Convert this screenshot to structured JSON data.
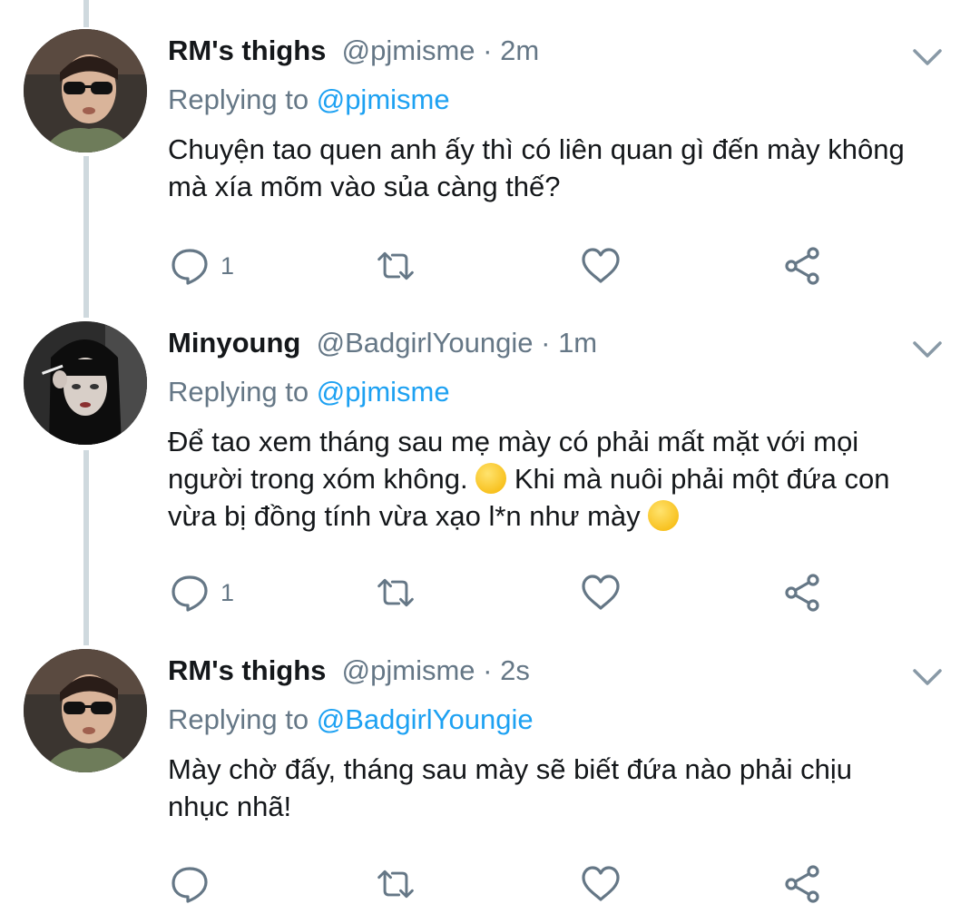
{
  "tweets": [
    {
      "name": "RM's thighs",
      "handle": "@pjmisme",
      "separator": "·",
      "time": "2m",
      "replying_prefix": "Replying to ",
      "replying_to": "@pjmisme",
      "text_lines": [
        "Chuyện tao quen anh ấy thì có liên quan gì đến mày không",
        "mà xía mõm vào sủa càng thế?"
      ],
      "reply_count": "1",
      "avatar": "man-sunglasses-avatar"
    },
    {
      "name": "Minyoung",
      "handle": "@BadgirlYoungie",
      "separator": "·",
      "time": "1m",
      "replying_prefix": "Replying to ",
      "replying_to": "@pjmisme",
      "text_line1": "Để tao xem tháng sau mẹ mày có phải mất mặt với mọi",
      "text_line2_a": "người trong xóm không. ",
      "text_line2_b": " Khi mà nuôi phải một đứa con",
      "text_line3": "vừa bị đồng tính vừa xạo l*n như mày ",
      "emoji": "smirking-face-emoji",
      "reply_count": "1",
      "avatar": "woman-dark-hair-avatar"
    },
    {
      "name": "RM's thighs",
      "handle": "@pjmisme",
      "separator": "·",
      "time": "2s",
      "replying_prefix": "Replying to ",
      "replying_to": "@BadgirlYoungie",
      "text_lines": [
        "Mày chờ đấy, tháng sau mày sẽ biết đứa nào phải chịu",
        "nhục nhã!"
      ],
      "reply_count": "",
      "avatar": "man-sunglasses-avatar"
    }
  ],
  "icons": {
    "reply": "comment-icon",
    "retweet": "retweet-icon",
    "like": "heart-icon",
    "share": "share-icon",
    "more": "chevron-down-icon"
  },
  "colors": {
    "link": "#1da1f2",
    "secondary": "#657786",
    "text": "#14171a",
    "icon": "#657786"
  }
}
